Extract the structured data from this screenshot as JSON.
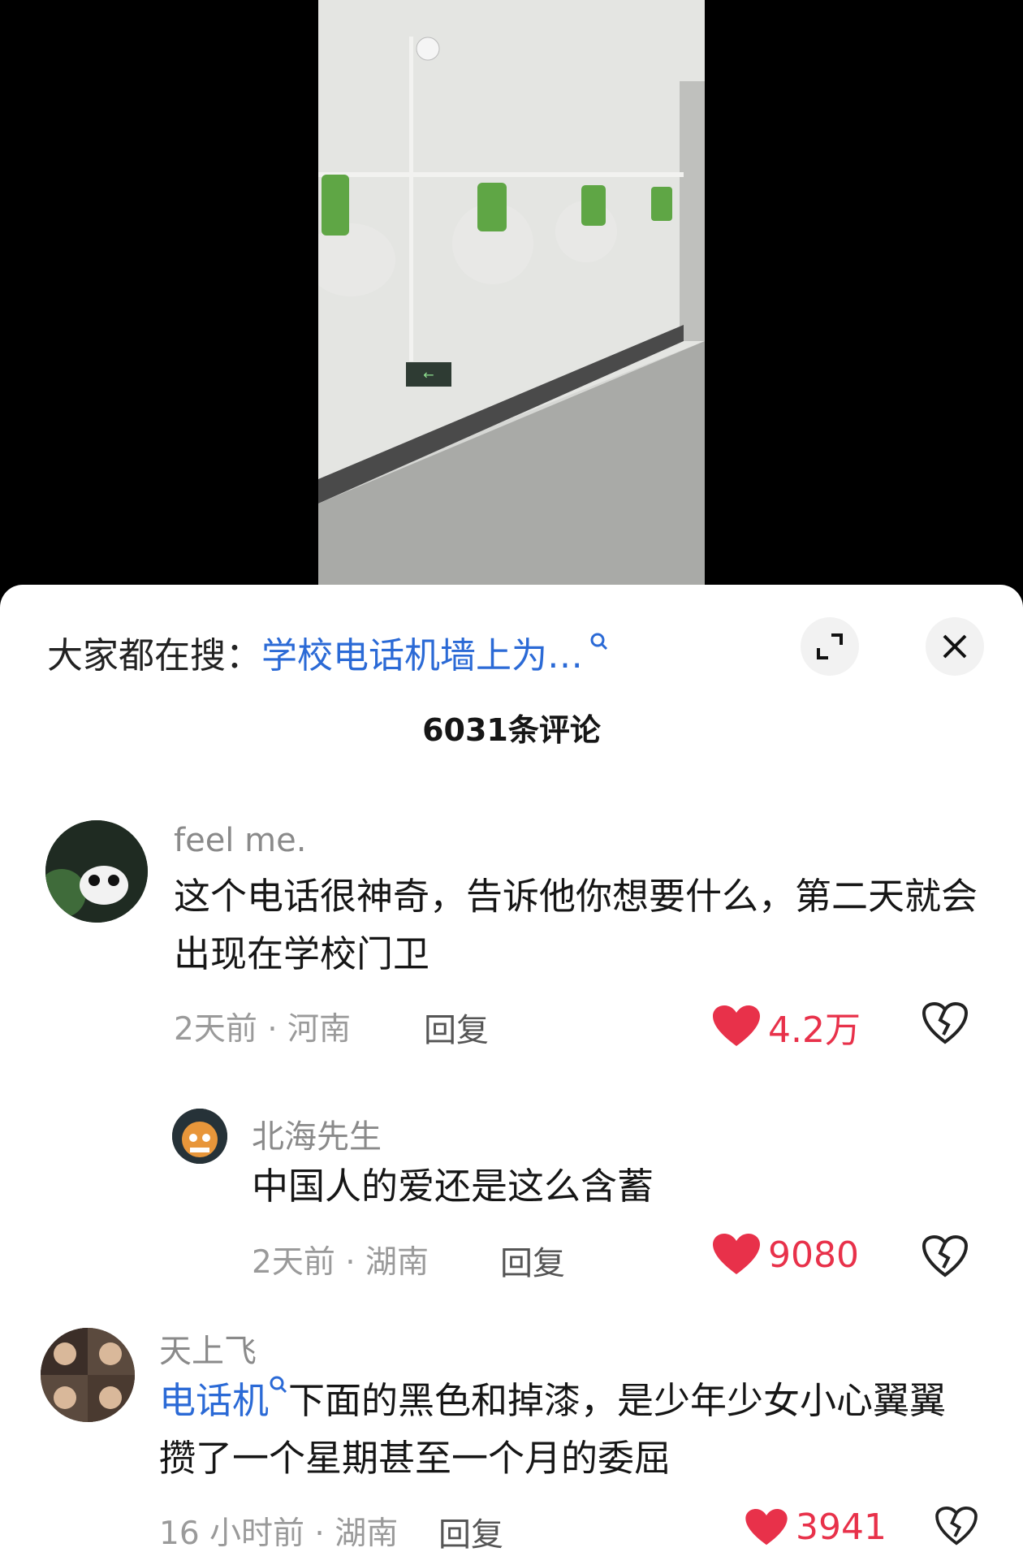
{
  "search": {
    "prefix": "大家都在搜：",
    "term": "学校电话机墙上为…"
  },
  "comment_count": "6031条评论",
  "comments": [
    {
      "username": "feel me.",
      "content": "这个电话很神奇，告诉他你想要什么，第二天就会出现在学校门卫",
      "meta": "2天前 · 河南",
      "reply": "回复",
      "likes": "4.2万"
    },
    {
      "username": "北海先生",
      "content": "中国人的爱还是这么含蓄",
      "meta": "2天前 · 湖南",
      "reply": "回复",
      "likes": "9080"
    },
    {
      "username": "天上飞",
      "content_link": "电话机",
      "content": "下面的黑色和掉漆，是少年少女小心翼翼攒了一个星期甚至一个月的委屈",
      "meta": "16 小时前 · 湖南",
      "reply": "回复",
      "likes": "3941"
    }
  ],
  "colors": {
    "like": "#e8314a",
    "link": "#2b6ad6"
  },
  "icons": [
    "search-icon",
    "expand-icon",
    "close-icon",
    "heart-icon",
    "broken-heart-icon"
  ]
}
